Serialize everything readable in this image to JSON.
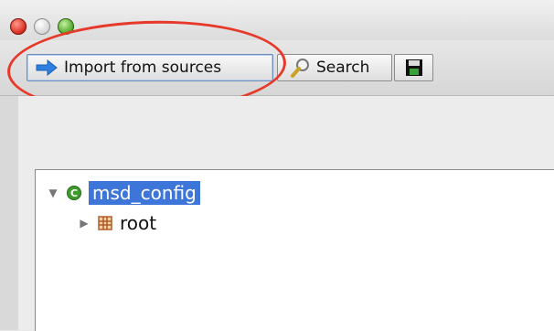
{
  "toolbar": {
    "import_label": "Import from sources",
    "search_label": "Search"
  },
  "tree": {
    "root_node": {
      "label": "msd_config",
      "expanded": true,
      "selected": true,
      "icon": "c-class-icon"
    },
    "child_node": {
      "label": "root",
      "expanded": false,
      "icon": "grid-icon"
    }
  },
  "colors": {
    "annotation": "#e6392a",
    "selection": "#3d75d8"
  }
}
